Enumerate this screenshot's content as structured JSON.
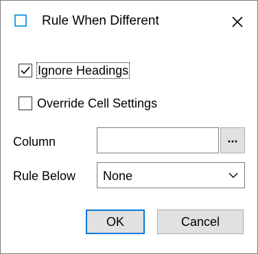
{
  "dialog": {
    "title": "Rule When Different",
    "title_icon": "window-icon",
    "close_icon": "close-icon"
  },
  "options": {
    "ignore_headings": {
      "label": "Ignore Headings",
      "checked": true
    },
    "override_cell_settings": {
      "label": "Override Cell Settings",
      "checked": false
    }
  },
  "column": {
    "label": "Column",
    "value": "",
    "browse_label": "..."
  },
  "rule_below": {
    "label": "Rule Below",
    "selected": "None"
  },
  "buttons": {
    "ok": "OK",
    "cancel": "Cancel"
  },
  "colors": {
    "accent": "#0078d7",
    "title_icon": "#2c9fe0",
    "button_face": "#e1e1e1"
  }
}
